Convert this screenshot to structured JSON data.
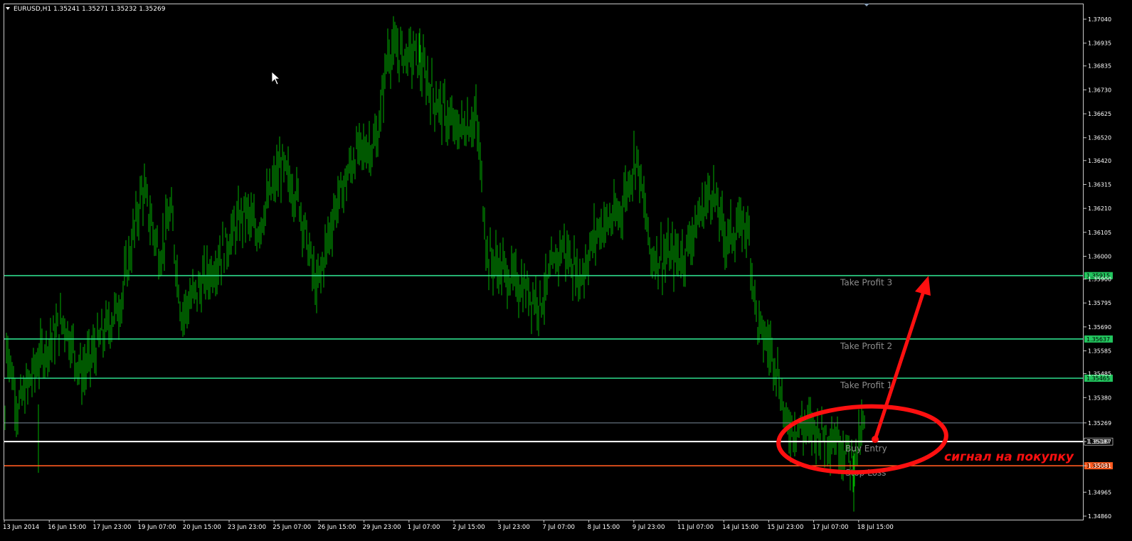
{
  "header": {
    "symbol_info": "EURUSD,H1  1.35241 1.35271 1.35232 1.35269",
    "menu_icon": "triangle-down-icon"
  },
  "price_axis": {
    "ticks": [
      "1.37040",
      "1.36935",
      "1.36835",
      "1.36730",
      "1.36625",
      "1.36520",
      "1.36420",
      "1.36315",
      "1.36210",
      "1.36105",
      "1.36000",
      "1.35900",
      "1.35795",
      "1.35690",
      "1.35585",
      "1.35485",
      "1.35380",
      "1.35269",
      "1.35187",
      "1.35081",
      "1.34965",
      "1.34860"
    ],
    "current_price": "1.35269"
  },
  "time_axis": {
    "ticks": [
      "13 Jun 2014",
      "16 Jun 15:00",
      "17 Jun 23:00",
      "19 Jun 07:00",
      "20 Jun 15:00",
      "23 Jun 23:00",
      "25 Jun 07:00",
      "26 Jun 15:00",
      "29 Jun 23:00",
      "1 Jul 07:00",
      "2 Jul 15:00",
      "3 Jul 23:00",
      "7 Jul 07:00",
      "8 Jul 15:00",
      "9 Jul 23:00",
      "11 Jul 07:00",
      "14 Jul 15:00",
      "15 Jul 23:00",
      "17 Jul 07:00",
      "18 Jul 15:00"
    ]
  },
  "levels": [
    {
      "name": "Take Profit 3",
      "price": "1.35915",
      "color": "#2edc8c",
      "tag_color": "#22c55e"
    },
    {
      "name": "Take Profit 2",
      "price": "1.35637",
      "color": "#2edc8c",
      "tag_color": "#22c55e"
    },
    {
      "name": "Take Profit 1",
      "price": "1.35465",
      "color": "#2edc8c",
      "tag_color": "#22c55e"
    },
    {
      "name": "Buy Entry",
      "price": "1.35187",
      "color": "#ffffff",
      "tag_color": "#000000"
    },
    {
      "name": "Stop Loss",
      "price": "1.35081",
      "color": "#ff5a1f",
      "tag_color": "#ff5a1f"
    }
  ],
  "annotation": {
    "text": "сигнал на покупку",
    "color": "#ff1010"
  },
  "colors": {
    "background": "#000000",
    "bars": "#00b000",
    "grid_border": "#c8c8c8",
    "bid_line": "#7a8a9a"
  },
  "chart_data": {
    "type": "bar",
    "symbol": "EURUSD",
    "timeframe": "H1",
    "x_range": [
      "13 Jun 2014",
      "18 Jul 2014"
    ],
    "ylim": [
      1.3486,
      1.3704
    ],
    "approx_close_path": [
      {
        "t": "13 Jun 2014",
        "p": 1.3558
      },
      {
        "t": "16 Jun 15:00",
        "p": 1.357
      },
      {
        "t": "17 Jun 23:00",
        "p": 1.3545
      },
      {
        "t": "19 Jun 07:00",
        "p": 1.363
      },
      {
        "t": "20 Jun 15:00",
        "p": 1.3595
      },
      {
        "t": "23 Jun 23:00",
        "p": 1.3605
      },
      {
        "t": "25 Jun 07:00",
        "p": 1.3635
      },
      {
        "t": "26 Jun 15:00",
        "p": 1.3615
      },
      {
        "t": "29 Jun 23:00",
        "p": 1.365
      },
      {
        "t": "1 Jul 07:00",
        "p": 1.369
      },
      {
        "t": "2 Jul 15:00",
        "p": 1.3655
      },
      {
        "t": "3 Jul 23:00",
        "p": 1.36
      },
      {
        "t": "7 Jul 07:00",
        "p": 1.3595
      },
      {
        "t": "8 Jul 15:00",
        "p": 1.361
      },
      {
        "t": "9 Jul 23:00",
        "p": 1.362
      },
      {
        "t": "11 Jul 07:00",
        "p": 1.3605
      },
      {
        "t": "14 Jul 15:00",
        "p": 1.362
      },
      {
        "t": "15 Jul 23:00",
        "p": 1.354
      },
      {
        "t": "17 Jul 07:00",
        "p": 1.3525
      },
      {
        "t": "18 Jul 15:00",
        "p": 1.3527
      }
    ]
  }
}
